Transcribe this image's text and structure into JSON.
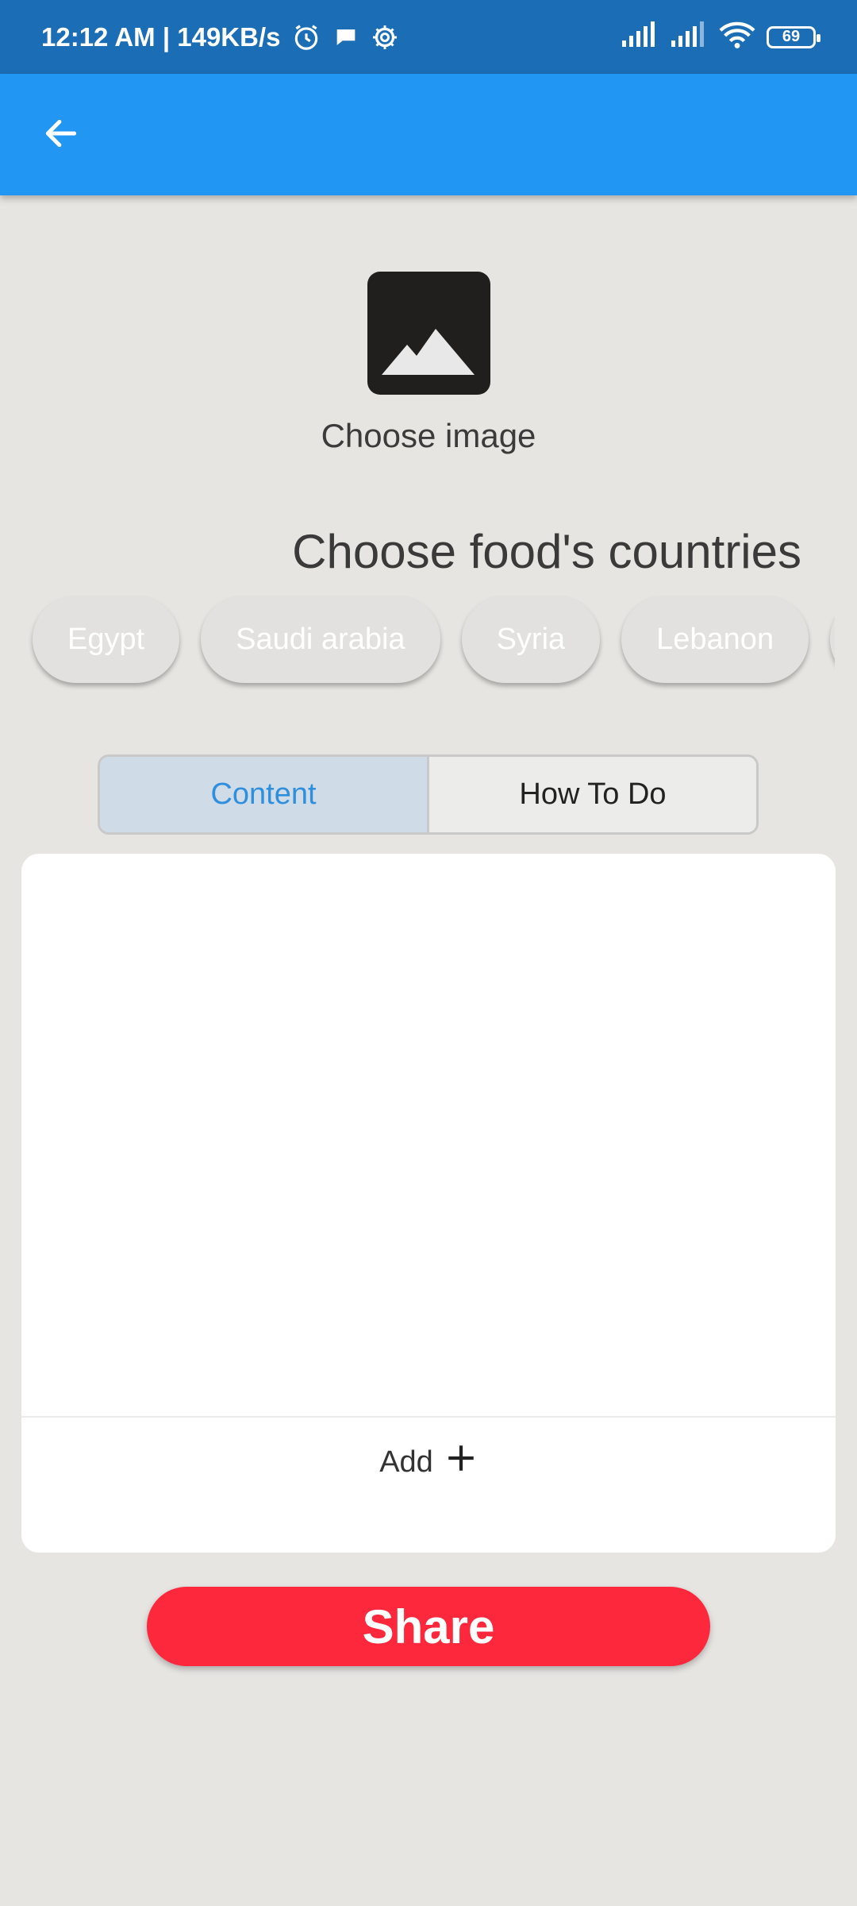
{
  "status_bar": {
    "time_speed": "12:12 AM | 149KB/s",
    "battery_level": "69",
    "icons": [
      "alarm-icon",
      "chat-bubble-icon",
      "settings-icon",
      "signal-icon",
      "signal-icon",
      "wifi-icon",
      "battery-icon"
    ]
  },
  "app_bar": {
    "back_icon": "arrow-left-icon",
    "color": "#2196f3"
  },
  "image_picker": {
    "label": "Choose image",
    "icon": "image-icon"
  },
  "countries": {
    "title": "Choose food's countries",
    "chips": [
      "Egypt",
      "Saudi arabia",
      "Syria",
      "Lebanon"
    ]
  },
  "tabs": [
    {
      "label": "Content",
      "active": true
    },
    {
      "label": "How To Do",
      "active": false
    }
  ],
  "content_card": {
    "add_label": "Add",
    "add_icon": "plus-icon"
  },
  "share_button": {
    "label": "Share",
    "color": "#fd283c"
  }
}
